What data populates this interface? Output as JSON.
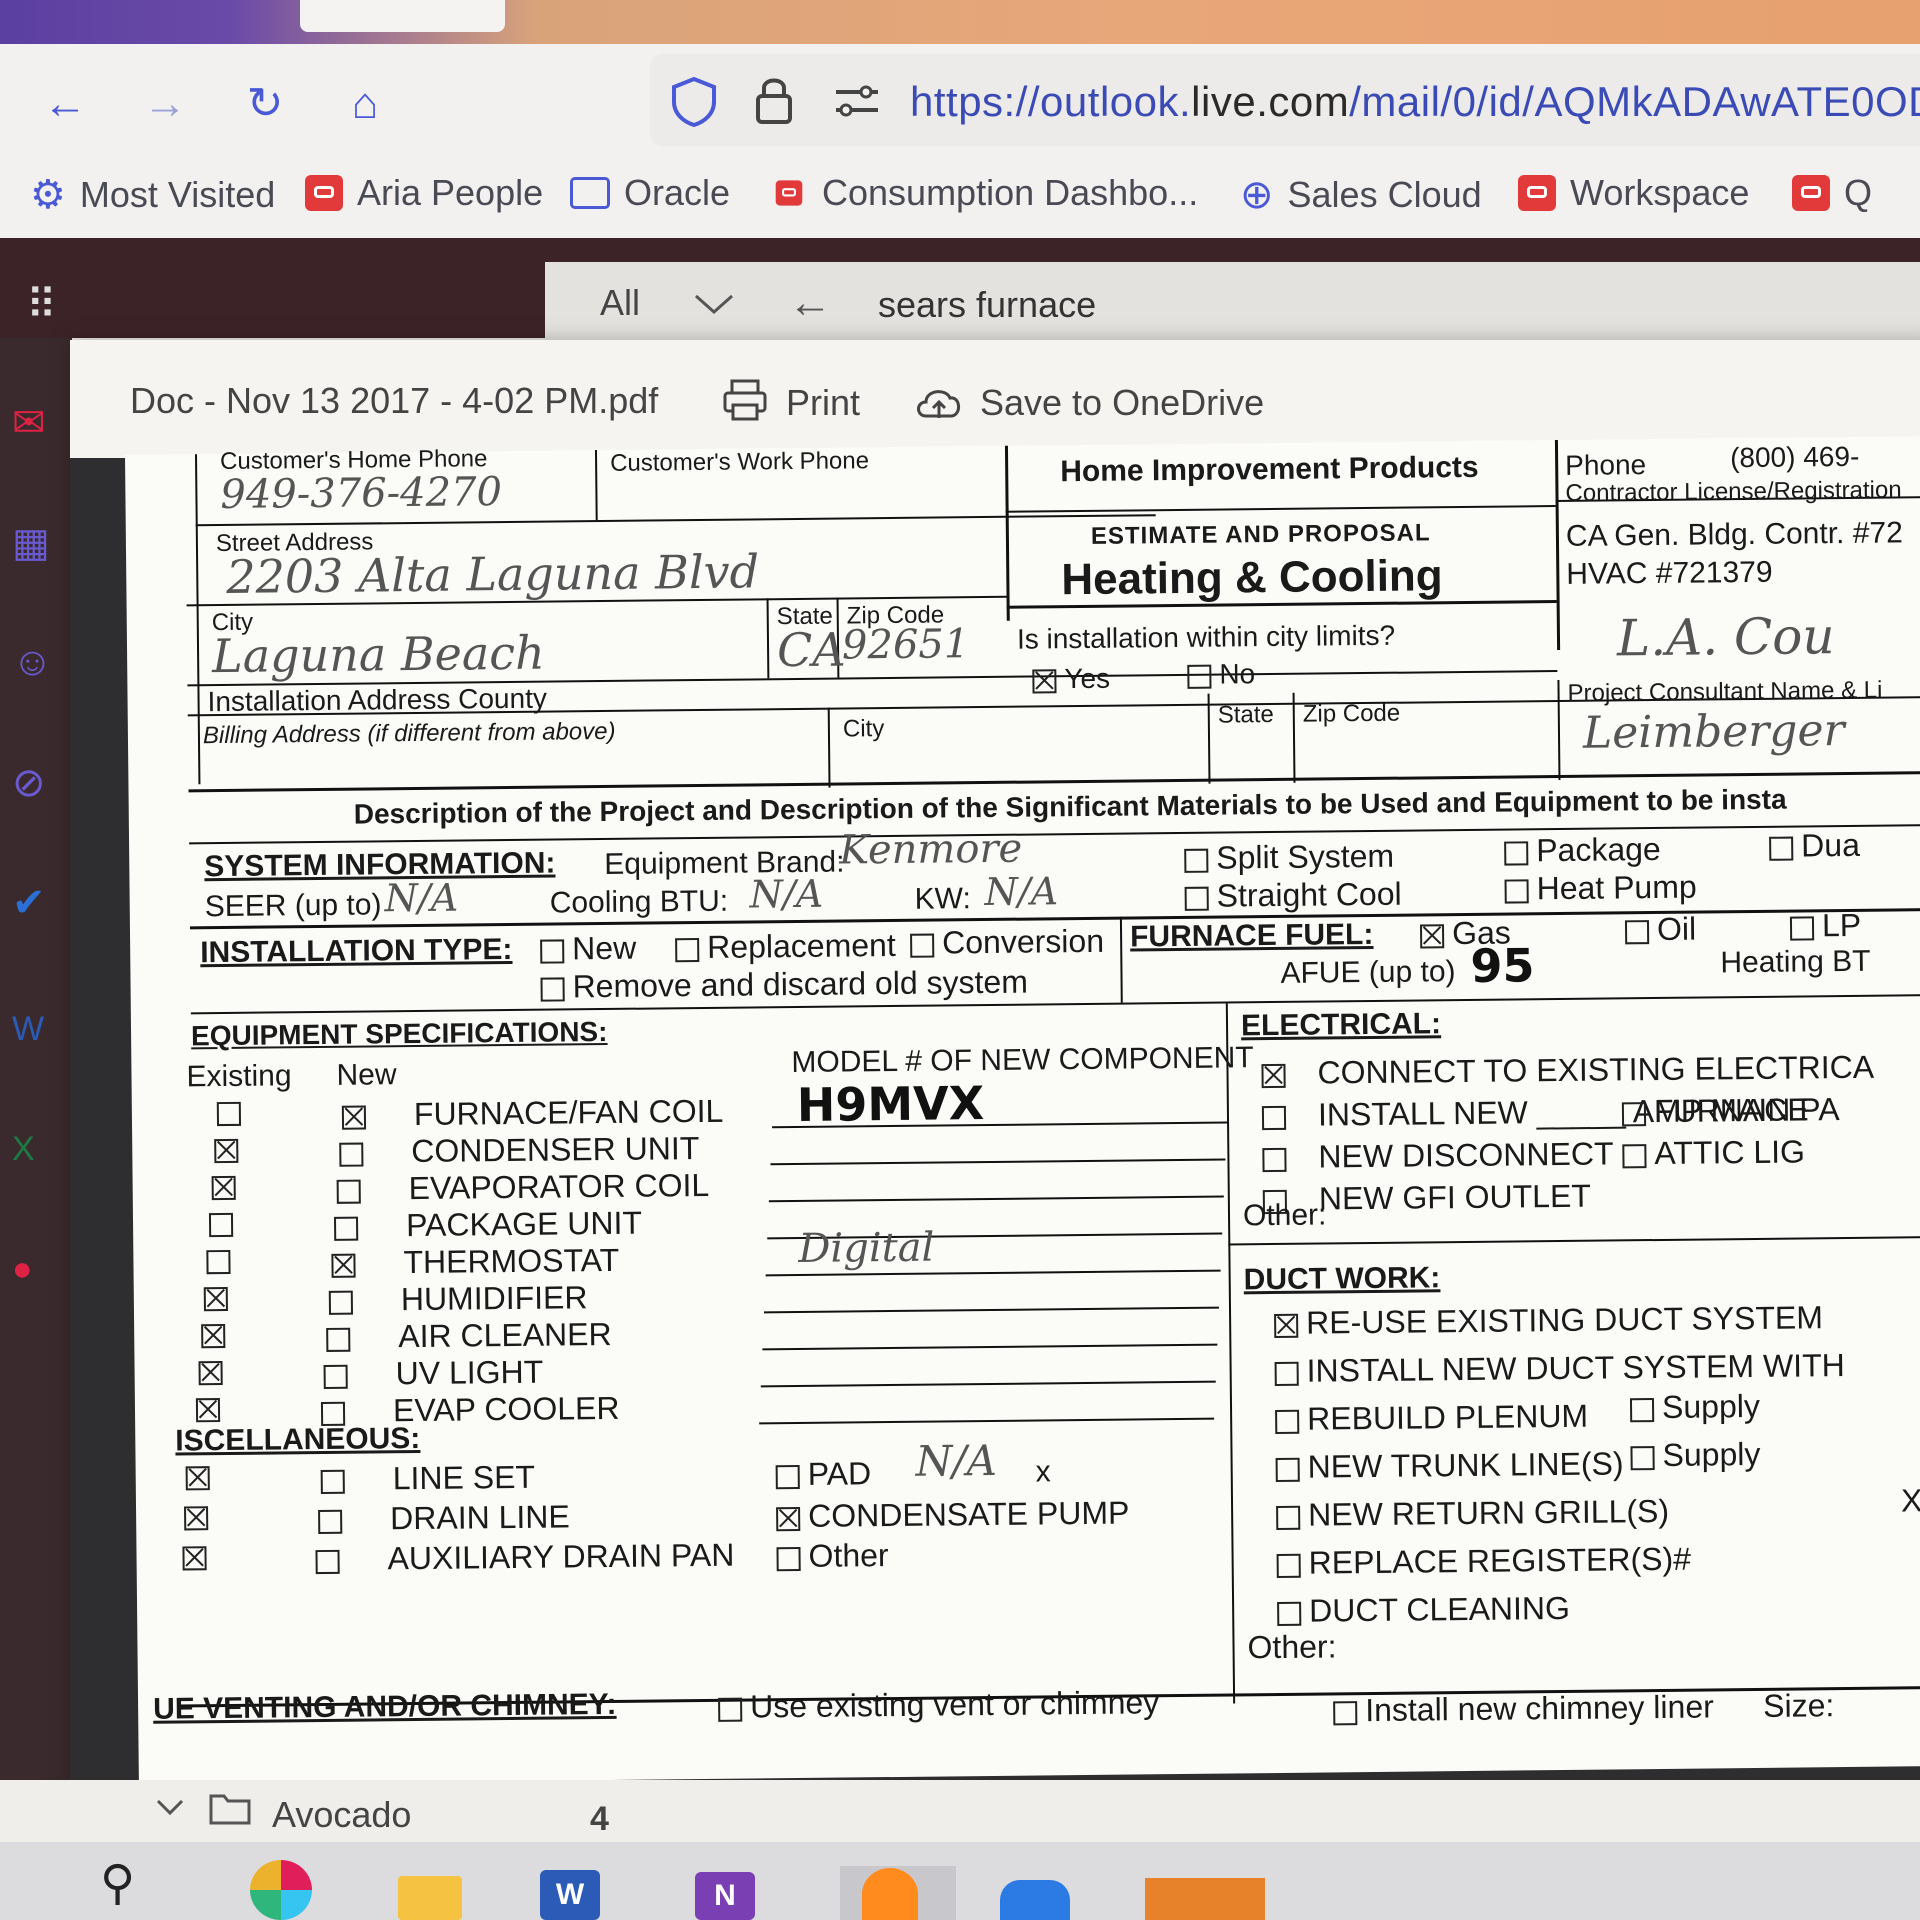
{
  "browser": {
    "nav": {
      "back": "←",
      "forward": "→",
      "reload": "↻",
      "home": "⌂"
    },
    "url_prefix": "https://outlook.",
    "url_host": "live.com",
    "url_rest": "/mail/0/id/AQMkADAwATE0OD",
    "bookmarks": [
      {
        "label": "Most Visited",
        "icon": "gear-icon"
      },
      {
        "label": "Aria People",
        "icon": "red-app-icon"
      },
      {
        "label": "Oracle",
        "icon": "folder-icon"
      },
      {
        "label": "Consumption Dashbo...",
        "icon": "red-app-icon"
      },
      {
        "label": "Sales Cloud",
        "icon": "globe-icon"
      },
      {
        "label": "Workspace",
        "icon": "red-app-icon"
      },
      {
        "label": "Q",
        "icon": "red-app-icon"
      }
    ]
  },
  "outlook": {
    "search_scope": "All",
    "search_query": "sears furnace"
  },
  "viewer": {
    "doc_name": "Doc - Nov 13 2017 - 4-02 PM.pdf",
    "print_label": "Print",
    "onedrive_label": "Save to OneDrive"
  },
  "form": {
    "customers_home_phone": "Customer's Home Phone",
    "customers_work_phone": "Customer's Work Phone",
    "home_phone_value": "949-376-4270",
    "street_address": "Street Address",
    "street_value": "2203 Alta Laguna Blvd",
    "city": "City",
    "state": "State",
    "zip": "Zip Code",
    "city_value": "Laguna Beach",
    "state_value": "CA",
    "zip_value": "92651",
    "install_county": "Installation Address County",
    "billing_address": "Billing Address (if different from above)",
    "billing_city": "City",
    "billing_state": "State",
    "billing_zip": "Zip Code",
    "company_line": "Home Improvement Products",
    "estimate": "ESTIMATE AND PROPOSAL",
    "heading": "Heating & Cooling",
    "city_limits_q": "Is installation within city limits?",
    "yes": "Yes",
    "no": "No",
    "phone_label": "Phone",
    "phone_value": "(800) 469-",
    "license_label": "Contractor License/Registration",
    "license_1": "CA Gen. Bldg. Contr. #72",
    "license_2": "HVAC #721379",
    "county_hw": "L.A. Cou",
    "consultant_label": "Project Consultant Name & Li",
    "consultant_value": "Leimberger",
    "description_bar": "Description of the Project and Description of the Significant Materials to be Used and Equipment to be insta",
    "system_info": "SYSTEM INFORMATION:",
    "equipment_brand": "Equipment Brand:",
    "brand_value": "Kenmore",
    "seer": "SEER (up to)",
    "seer_value": "N/A",
    "cooling_btu": "Cooling BTU:",
    "btu_value": "N/A",
    "kw": "KW:",
    "kw_value": "N/A",
    "split_system": "Split System",
    "straight_cool": "Straight Cool",
    "package": "Package",
    "heat_pump": "Heat Pump",
    "dual": "Dua",
    "installation_type": "INSTALLATION TYPE:",
    "new": "New",
    "replacement": "Replacement",
    "conversion": "Conversion",
    "remove_discard": "Remove and discard old system",
    "furnace_fuel": "FURNACE FUEL:",
    "gas": "Gas",
    "oil": "Oil",
    "lp": "LP",
    "afue": "AFUE (up to)",
    "afue_value": "95",
    "heating_bt": "Heating BT",
    "equipment_specs": "EQUIPMENT SPECIFICATIONS:",
    "existing": "Existing",
    "new_col": "New",
    "model_header": "MODEL # OF NEW COMPONENT",
    "equipment": [
      {
        "label": "FURNACE/FAN COIL",
        "existing": false,
        "new": true,
        "model": "H9MVX"
      },
      {
        "label": "CONDENSER UNIT",
        "existing": true,
        "new": false,
        "model": ""
      },
      {
        "label": "EVAPORATOR COIL",
        "existing": true,
        "new": false,
        "model": ""
      },
      {
        "label": "PACKAGE UNIT",
        "existing": false,
        "new": false,
        "model": ""
      },
      {
        "label": "THERMOSTAT",
        "existing": false,
        "new": true,
        "model": "Digital"
      },
      {
        "label": "HUMIDIFIER",
        "existing": true,
        "new": false,
        "model": ""
      },
      {
        "label": "AIR CLEANER",
        "existing": true,
        "new": false,
        "model": ""
      },
      {
        "label": "UV LIGHT",
        "existing": true,
        "new": false,
        "model": ""
      },
      {
        "label": "EVAP COOLER",
        "existing": true,
        "new": false,
        "model": ""
      }
    ],
    "miscellaneous": "ISCELLANEOUS:",
    "misc": [
      {
        "label": "LINE SET",
        "existing": true,
        "new": false
      },
      {
        "label": "DRAIN LINE",
        "existing": true,
        "new": false
      },
      {
        "label": "AUXILIARY DRAIN PAN",
        "existing": true,
        "new": false
      }
    ],
    "pad": "PAD",
    "pad_value": "N/A",
    "pad_x": "x",
    "condensate_pump": "CONDENSATE PUMP",
    "other": "Other",
    "electrical": "ELECTRICAL:",
    "elec_items": [
      {
        "label": "CONNECT TO EXISTING ELECTRICA",
        "checked": true
      },
      {
        "label": "INSTALL NEW _____ AMP MAIN PA",
        "checked": false
      },
      {
        "label": "NEW DISCONNECT",
        "checked": false
      },
      {
        "label": "NEW GFI OUTLET",
        "checked": false
      }
    ],
    "furnace_short": "FURNACE",
    "attic_light": "ATTIC LIG",
    "elec_other": "Other:",
    "duct_work": "DUCT WORK:",
    "duct_items": [
      {
        "label": "RE-USE EXISTING DUCT SYSTEM",
        "checked": true
      },
      {
        "label": "INSTALL NEW DUCT SYSTEM WITH",
        "checked": false
      },
      {
        "label": "REBUILD PLENUM",
        "checked": false
      },
      {
        "label": "NEW TRUNK LINE(S)",
        "checked": false
      },
      {
        "label": "NEW RETURN GRILL(S)",
        "checked": false
      },
      {
        "label": "REPLACE REGISTER(S)#",
        "checked": false
      },
      {
        "label": "DUCT CLEANING",
        "checked": false
      }
    ],
    "supply": "Supply",
    "duct_x": "X",
    "duct_other": "Other:",
    "venting": "UE VENTING AND/OR CHIMNEY:",
    "use_existing_vent": "Use existing vent or chimney",
    "install_chimney_liner": "Install new chimney liner",
    "size": "Size:"
  },
  "folder": {
    "name": "Avocado",
    "count": "4"
  },
  "colors": {
    "accent": "#4a5ad6",
    "outlook_dark": "#3c2328",
    "bookmark_red": "#e23a3a"
  }
}
